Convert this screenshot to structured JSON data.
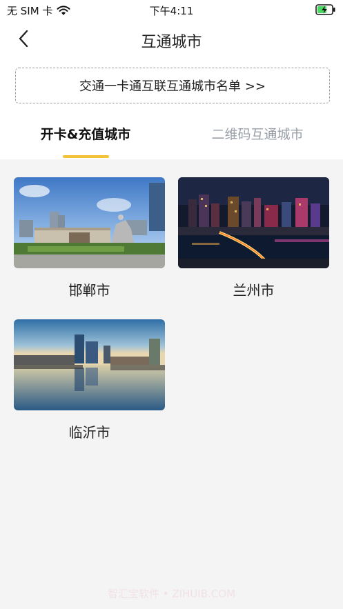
{
  "status_bar": {
    "carrier": "无 SIM 卡",
    "time": "下午4:11",
    "wifi_icon": "wifi-icon",
    "battery_icon": "battery-charging-icon"
  },
  "nav": {
    "title": "互通城市",
    "back_icon": "chevron-left-icon"
  },
  "list_link": {
    "label": "交通一卡通互联互通城市名单 >>"
  },
  "tabs": [
    {
      "label": "开卡&充值城市",
      "active": true
    },
    {
      "label": "二维码互通城市",
      "active": false
    }
  ],
  "colors": {
    "accent": "#f2c33a",
    "inactive_tab": "#9aa0a8",
    "background": "#f4f4f4"
  },
  "cities": [
    {
      "name": "邯郸市"
    },
    {
      "name": "兰州市"
    },
    {
      "name": "临沂市"
    }
  ],
  "watermark": "智汇宝软件 • ZIHUIB.COM"
}
